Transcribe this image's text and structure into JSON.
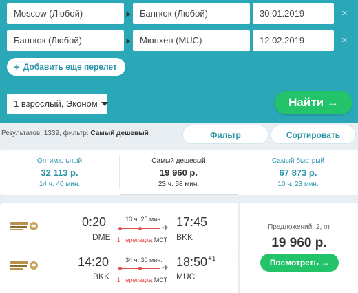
{
  "search": {
    "legs": [
      {
        "from": "Moscow (Любой)",
        "to": "Бангкок (Любой)",
        "date": "30.01.2019"
      },
      {
        "from": "Бангкок (Любой)",
        "to": "Мюнхен (MUC)",
        "date": "12.02.2019"
      }
    ],
    "add_flight_label": "Добавить еще перелет",
    "add_flight_icon": "+",
    "passengers": "1 взрослый, Эконом",
    "find_label": "Найти →",
    "clear_icon": "×",
    "leg_separator_icon": "▶"
  },
  "results": {
    "info_prefix": "Результатов: 1339, фильтр:",
    "filter_name": "Самый дешевый",
    "filter_button": "Фильтр",
    "sort_button": "Сортировать"
  },
  "tabs": [
    {
      "title": "Оптимальный",
      "price": "32 113 р.",
      "duration": "14 ч. 40 мин.",
      "active": false
    },
    {
      "title": "Самый дешевый",
      "price": "19 960 р.",
      "duration": "23 ч. 58 мин.",
      "active": true
    },
    {
      "title": "Самый быстрый",
      "price": "67 873 р.",
      "duration": "10 ч. 23 мин.",
      "active": false
    }
  ],
  "ticket": {
    "segments": [
      {
        "dep_time": "0:20",
        "dep_code": "DME",
        "duration": "13 ч. 25 мин.",
        "arr_time": "17:45",
        "arr_sup": "",
        "arr_code": "BKK",
        "stops": "1 пересадка",
        "hub": "MCT"
      },
      {
        "dep_time": "14:20",
        "dep_code": "BKK",
        "duration": "34 ч. 30 мин.",
        "arr_time": "18:50",
        "arr_sup": "+1",
        "arr_code": "MUC",
        "stops": "1 пересадка",
        "hub": "MCT"
      }
    ],
    "plane_icon": "✈",
    "offers": "Предложений: 2, от",
    "price": "19 960 р.",
    "view_label": "Посмотреть →"
  },
  "colors": {
    "panel": "#2aa8b8",
    "accent_green": "#23c36a",
    "link_teal": "#2a94a8",
    "transfer_red": "#e05050"
  }
}
